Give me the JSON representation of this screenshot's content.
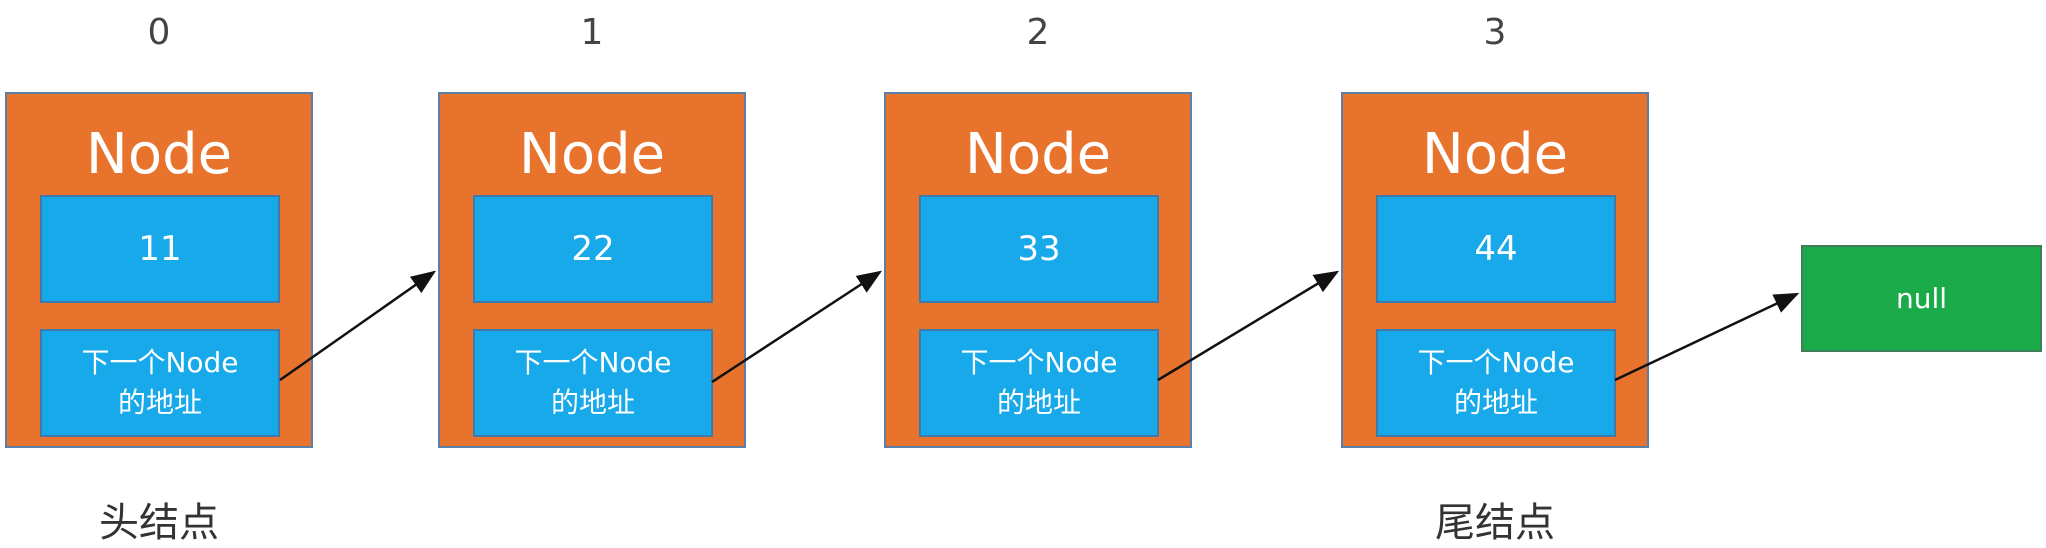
{
  "nodes": [
    {
      "index": "0",
      "title": "Node",
      "value": "11",
      "addr_line1": "下一个Node",
      "addr_line2": "的地址"
    },
    {
      "index": "1",
      "title": "Node",
      "value": "22",
      "addr_line1": "下一个Node",
      "addr_line2": "的地址"
    },
    {
      "index": "2",
      "title": "Node",
      "value": "33",
      "addr_line1": "下一个Node",
      "addr_line2": "的地址"
    },
    {
      "index": "3",
      "title": "Node",
      "value": "44",
      "addr_line1": "下一个Node",
      "addr_line2": "的地址"
    }
  ],
  "null_label": "null",
  "head_label": "头结点",
  "tail_label": "尾结点",
  "colors": {
    "node": "#E8732D",
    "field": "#17A9EA",
    "null": "#1BAA4A"
  }
}
